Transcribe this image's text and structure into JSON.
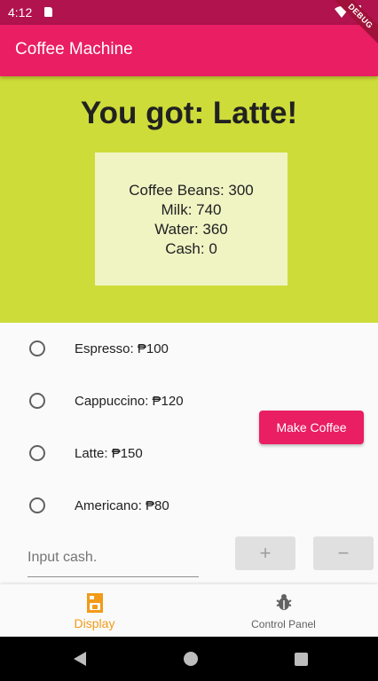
{
  "status_bar": {
    "time": "4:12",
    "debug_label": "DEBUG"
  },
  "app_bar": {
    "title": "Coffee Machine"
  },
  "display": {
    "result": "You got: Latte!",
    "inventory": {
      "coffee_beans": "Coffee Beans: 300",
      "milk": "Milk: 740",
      "water": "Water: 360",
      "cash": "Cash: 0"
    }
  },
  "options": [
    {
      "label": "Espresso: ₱100",
      "selected": false
    },
    {
      "label": "Cappuccino: ₱120",
      "selected": false
    },
    {
      "label": "Latte: ₱150",
      "selected": false
    },
    {
      "label": "Americano: ₱80",
      "selected": false
    }
  ],
  "make_coffee_label": "Make Coffee",
  "cash_input": {
    "placeholder": "Input cash.",
    "value": ""
  },
  "buttons": {
    "plus": "+",
    "minus": "−"
  },
  "bottom_nav": [
    {
      "label": "Display",
      "icon": "coffee-machine-icon",
      "active": true
    },
    {
      "label": "Control Panel",
      "icon": "bug-icon",
      "active": false
    }
  ],
  "colors": {
    "primary": "#e91e63",
    "status_bar": "#b0134e",
    "display_bg": "#cddc39",
    "card_bg": "#f0f4c3",
    "nav_active": "#f29b19"
  }
}
